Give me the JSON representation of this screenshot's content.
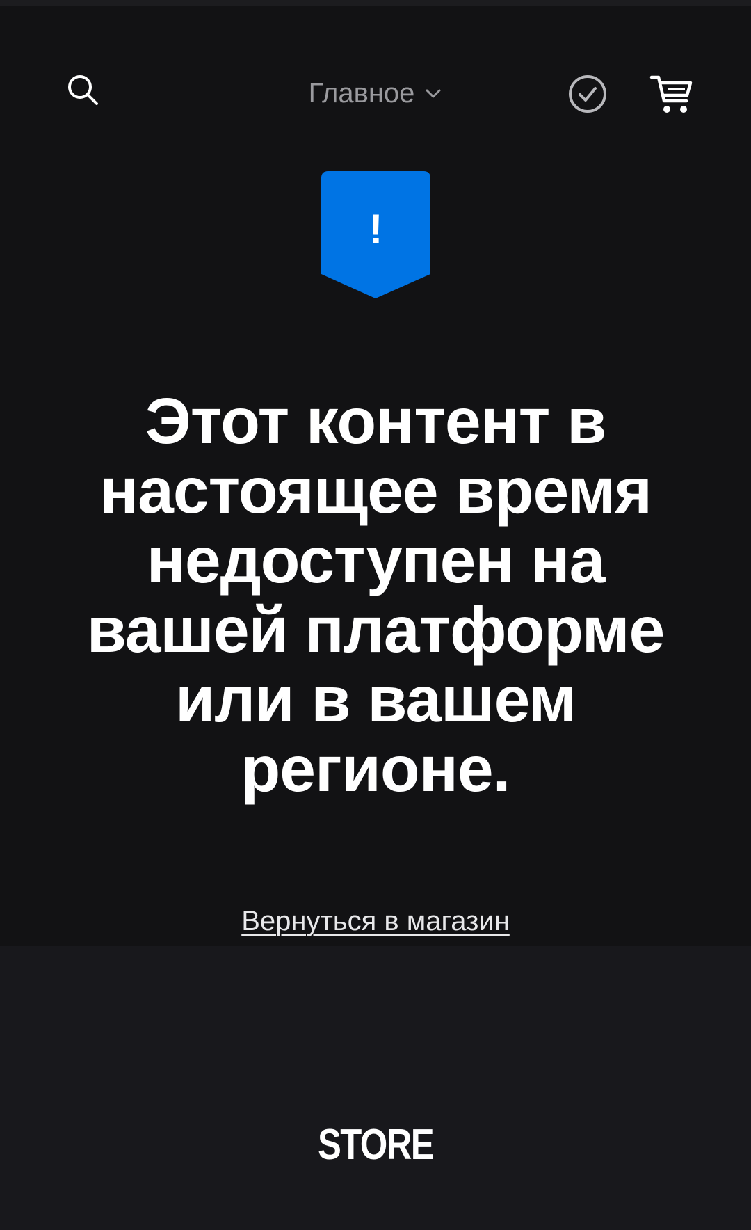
{
  "header": {
    "nav_label": "Главное",
    "icons": {
      "search": "search-icon",
      "chevron": "chevron-down-icon",
      "check": "check-circle-icon",
      "cart": "cart-icon"
    }
  },
  "notice": {
    "badge_symbol": "!",
    "badge_color": "#0074e4",
    "message": "Этот контент в\nнастоящее время\nнедоступен на\nвашей платформе\nили в вашем\nрегионе.",
    "back_link": "Вернуться в магазин"
  },
  "footer": {
    "logo": "STORE"
  }
}
